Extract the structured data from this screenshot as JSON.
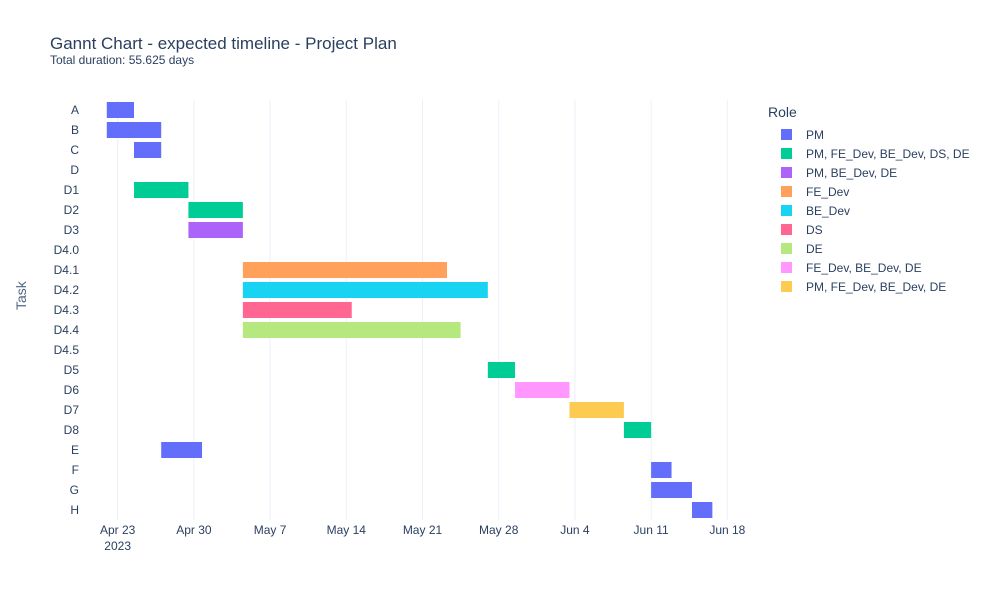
{
  "chart_data": {
    "type": "gantt",
    "title": "Gannt Chart - expected timeline - Project Plan",
    "subtitle": "Total duration: 55.625 days",
    "ylabel": "Task",
    "xlabel": "",
    "legend_title": "Role",
    "legend_position": "right",
    "grid": true,
    "x_range": [
      "2023-04-20",
      "2023-06-21"
    ],
    "x_ticks": [
      {
        "date": "2023-04-23",
        "label": "Apr 23",
        "sublabel": "2023"
      },
      {
        "date": "2023-04-30",
        "label": "Apr 30"
      },
      {
        "date": "2023-05-07",
        "label": "May 7"
      },
      {
        "date": "2023-05-14",
        "label": "May 14"
      },
      {
        "date": "2023-05-21",
        "label": "May 21"
      },
      {
        "date": "2023-05-28",
        "label": "May 28"
      },
      {
        "date": "2023-06-04",
        "label": "Jun 4"
      },
      {
        "date": "2023-06-11",
        "label": "Jun 11"
      },
      {
        "date": "2023-06-18",
        "label": "Jun 18"
      }
    ],
    "categories": [
      "A",
      "B",
      "C",
      "D",
      "D1",
      "D2",
      "D3",
      "D4.0",
      "D4.1",
      "D4.2",
      "D4.3",
      "D4.4",
      "D4.5",
      "D5",
      "D6",
      "D7",
      "D8",
      "E",
      "F",
      "G",
      "H"
    ],
    "roles": [
      {
        "name": "PM",
        "color": "#636efa"
      },
      {
        "name": "PM, FE_Dev, BE_Dev, DS, DE",
        "color": "#00cc96"
      },
      {
        "name": "PM, BE_Dev, DE",
        "color": "#ab63fa"
      },
      {
        "name": "FE_Dev",
        "color": "#ffa15a"
      },
      {
        "name": "BE_Dev",
        "color": "#19d3f3"
      },
      {
        "name": "DS",
        "color": "#ff6692"
      },
      {
        "name": "DE",
        "color": "#b6e880"
      },
      {
        "name": "FE_Dev, BE_Dev, DE",
        "color": "#ff97ff"
      },
      {
        "name": "PM, FE_Dev, BE_Dev, DE",
        "color": "#fecb52"
      }
    ],
    "tasks": [
      {
        "task": "A",
        "start": "2023-04-22",
        "end": "2023-04-24.5",
        "role": "PM"
      },
      {
        "task": "B",
        "start": "2023-04-22",
        "end": "2023-04-27",
        "role": "PM"
      },
      {
        "task": "C",
        "start": "2023-04-24.5",
        "end": "2023-04-27",
        "role": "PM"
      },
      {
        "task": "D1",
        "start": "2023-04-24.5",
        "end": "2023-04-29.5",
        "role": "PM, FE_Dev, BE_Dev, DS, DE"
      },
      {
        "task": "D2",
        "start": "2023-04-29.5",
        "end": "2023-05-04.5",
        "role": "PM, FE_Dev, BE_Dev, DS, DE"
      },
      {
        "task": "D3",
        "start": "2023-04-29.5",
        "end": "2023-05-04.5",
        "role": "PM, BE_Dev, DE"
      },
      {
        "task": "D4.1",
        "start": "2023-05-04.5",
        "end": "2023-05-23.25",
        "role": "FE_Dev"
      },
      {
        "task": "D4.2",
        "start": "2023-05-04.5",
        "end": "2023-05-27",
        "role": "BE_Dev"
      },
      {
        "task": "D4.3",
        "start": "2023-05-04.5",
        "end": "2023-05-14.5",
        "role": "DS"
      },
      {
        "task": "D4.4",
        "start": "2023-05-04.5",
        "end": "2023-05-24.5",
        "role": "DE"
      },
      {
        "task": "D5",
        "start": "2023-05-27",
        "end": "2023-05-29.5",
        "role": "PM, FE_Dev, BE_Dev, DS, DE"
      },
      {
        "task": "D6",
        "start": "2023-05-29.5",
        "end": "2023-06-03.5",
        "role": "FE_Dev, BE_Dev, DE"
      },
      {
        "task": "D7",
        "start": "2023-06-03.5",
        "end": "2023-06-08.5",
        "role": "PM, FE_Dev, BE_Dev, DE"
      },
      {
        "task": "D8",
        "start": "2023-06-08.5",
        "end": "2023-06-11",
        "role": "PM, FE_Dev, BE_Dev, DS, DE"
      },
      {
        "task": "E",
        "start": "2023-04-27",
        "end": "2023-04-30.75",
        "role": "PM"
      },
      {
        "task": "F",
        "start": "2023-06-11",
        "end": "2023-06-12.875",
        "role": "PM"
      },
      {
        "task": "G",
        "start": "2023-06-11",
        "end": "2023-06-14.75",
        "role": "PM"
      },
      {
        "task": "H",
        "start": "2023-06-14.75",
        "end": "2023-06-16.625",
        "role": "PM"
      }
    ]
  }
}
